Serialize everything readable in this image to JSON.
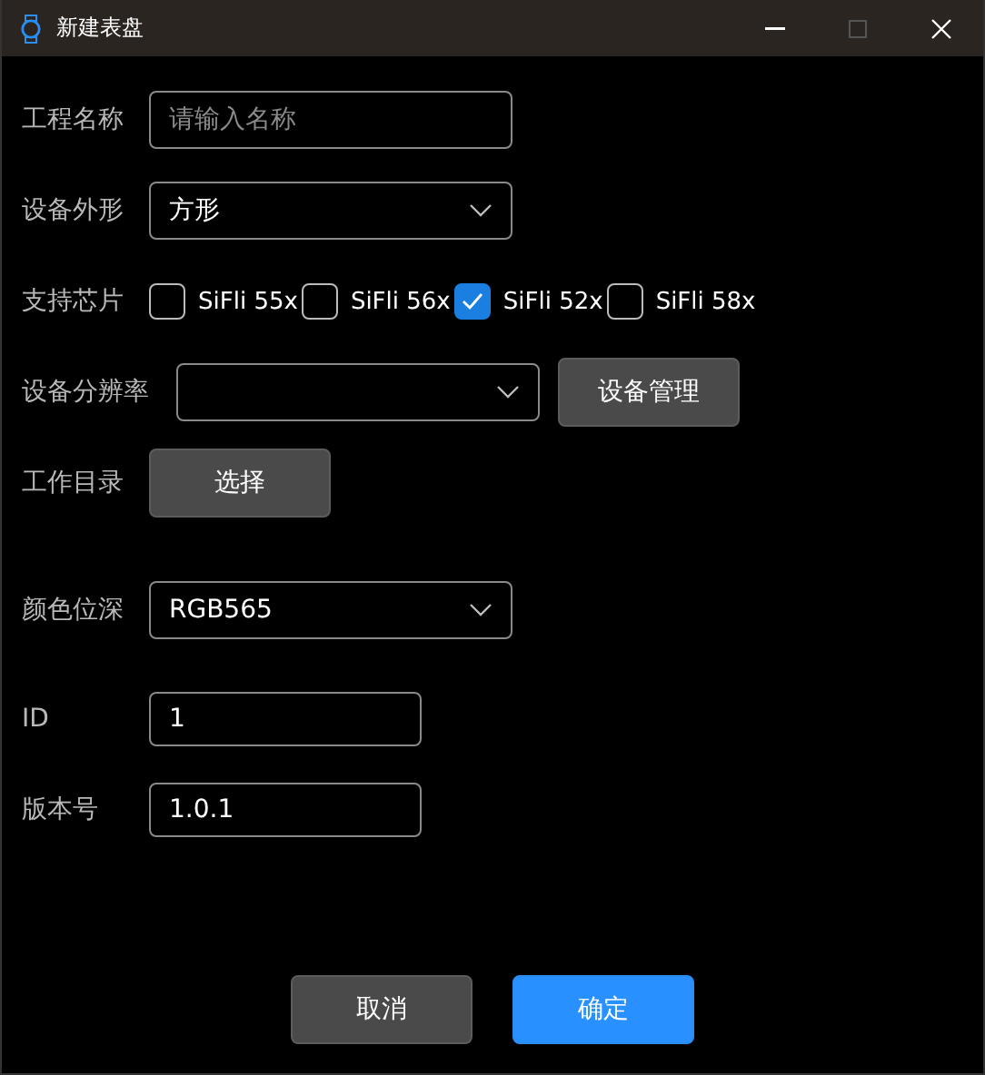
{
  "window": {
    "title": "新建表盘"
  },
  "fields": [
    {
      "kind": "input",
      "label": "工程名称",
      "placeholder": "请输入名称"
    },
    {
      "kind": "select",
      "label": "设备外形",
      "value": "方形"
    },
    {
      "kind": "checks",
      "label": "支持芯片",
      "options": [
        {
          "label": "SiFli 55x",
          "checked": false
        },
        {
          "label": "SiFli 56x",
          "checked": false
        },
        {
          "label": "SiFli 52x",
          "checked": true
        },
        {
          "label": "SiFli 58x",
          "checked": false
        }
      ]
    },
    {
      "kind": "select_button",
      "label": "设备分辨率",
      "button": "设备管理"
    },
    {
      "kind": "button",
      "label": "工作目录",
      "button": "选择"
    },
    {
      "kind": "select",
      "label": "颜色位深",
      "value": "RGB565"
    },
    {
      "kind": "short_input",
      "label": "ID",
      "value": "1"
    },
    {
      "kind": "short_input",
      "label": "版本号",
      "value": "1.0.1"
    }
  ],
  "buttons": [
    {
      "label": "取消",
      "primary": false
    },
    {
      "label": "确定",
      "primary": true
    }
  ]
}
